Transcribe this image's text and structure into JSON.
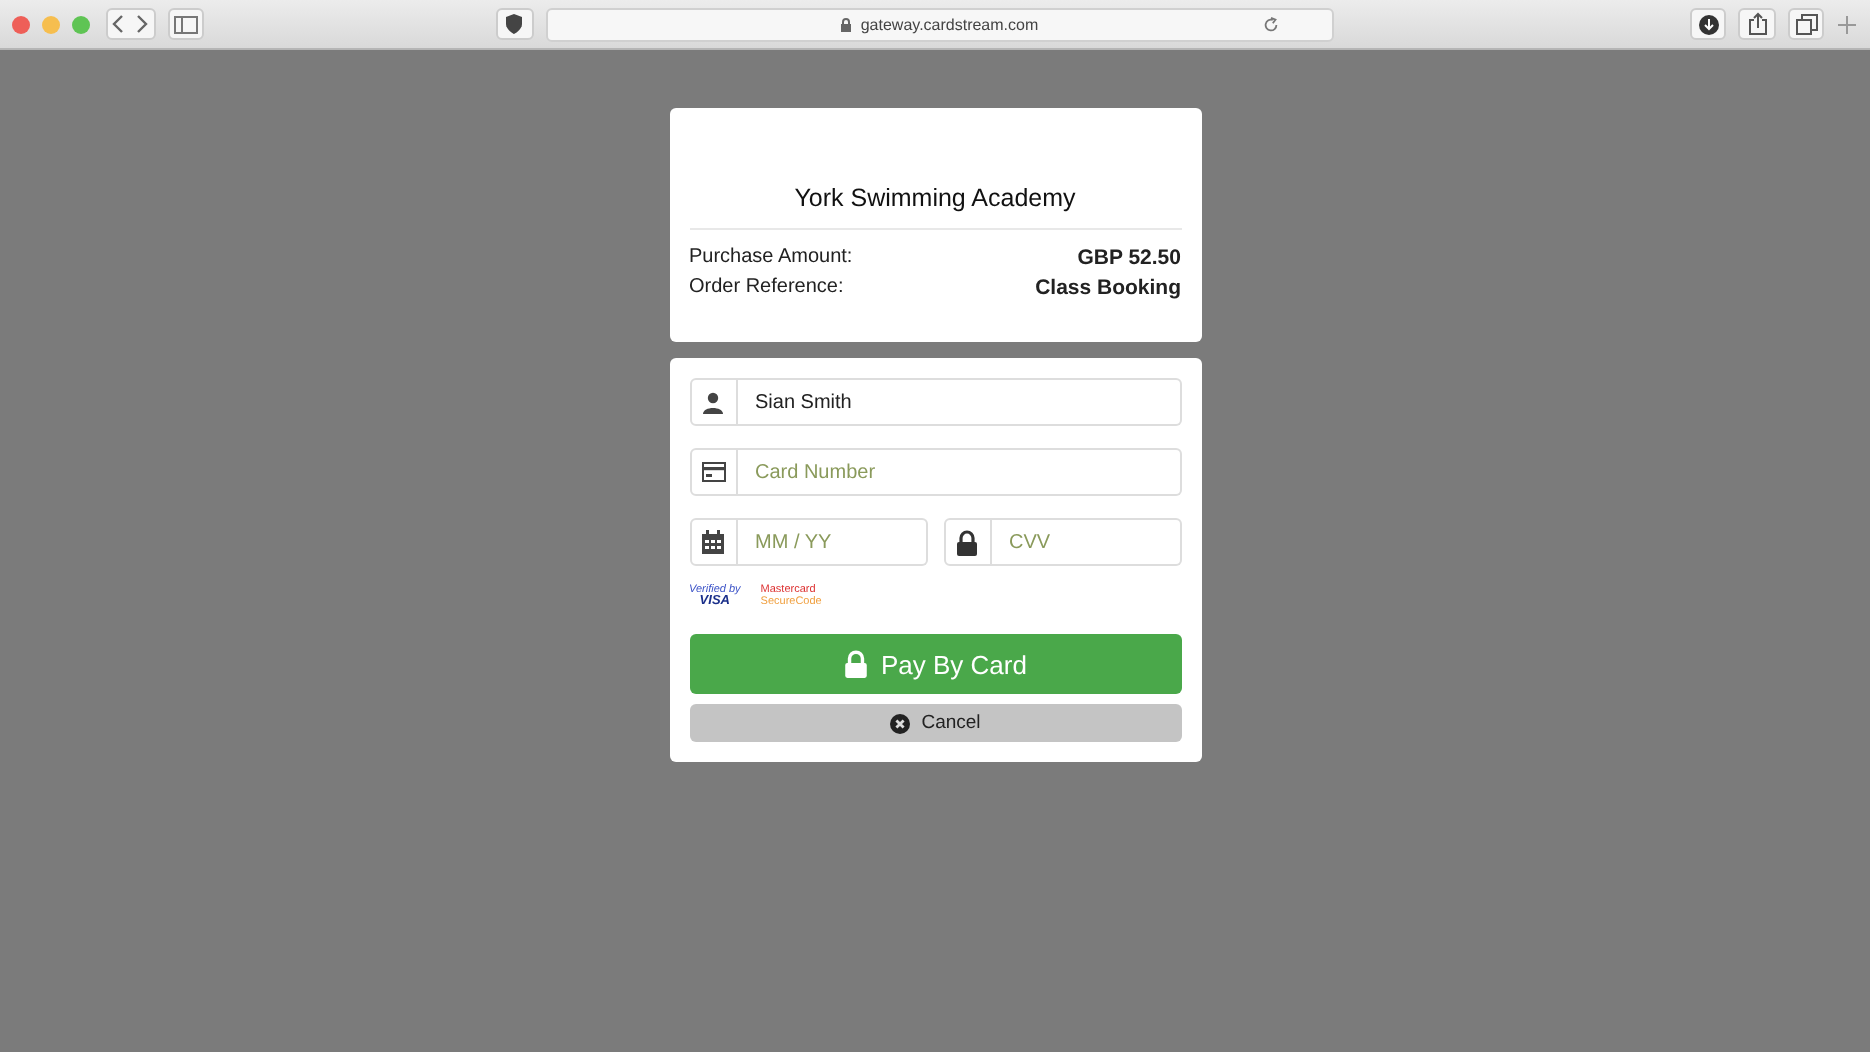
{
  "browser": {
    "url": "gateway.cardstream.com"
  },
  "merchant": {
    "name": "York Swimming Academy",
    "rows": [
      {
        "label": "Purchase Amount:",
        "value": "GBP  52.50"
      },
      {
        "label": "Order Reference:",
        "value": "Class Booking"
      }
    ]
  },
  "fields": [
    {
      "kind": "person",
      "value": "Sian Smith"
    },
    {
      "kind": "card",
      "placeholder": "Card Number"
    },
    {
      "kind": "calendar",
      "placeholder": "MM / YY"
    },
    {
      "kind": "lock",
      "placeholder": "CVV"
    }
  ],
  "badges": {
    "visa": [
      "Verified by",
      "VISA"
    ],
    "mastercard": [
      "Mastercard",
      "SecureCode"
    ]
  },
  "pay_button": "Pay By Card",
  "cancel_button": "Cancel"
}
